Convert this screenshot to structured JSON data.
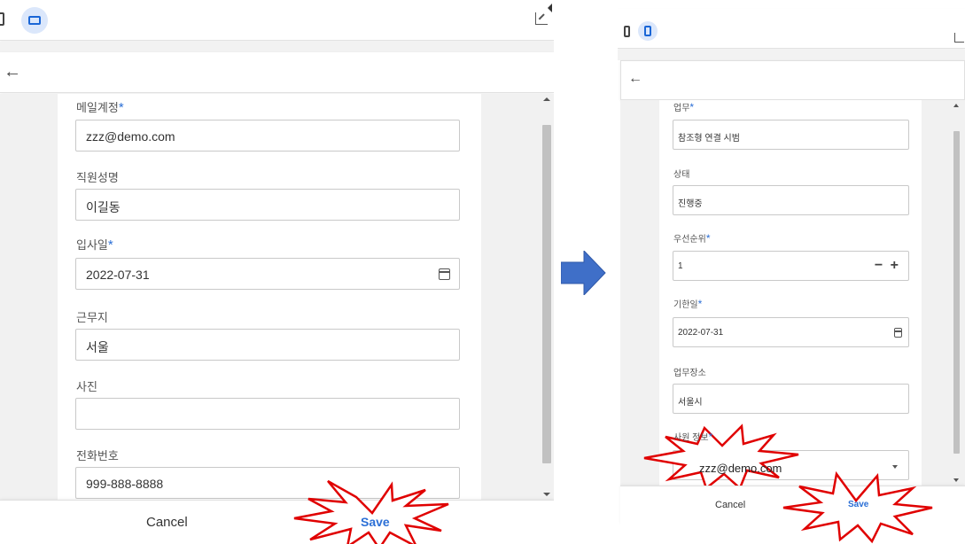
{
  "left": {
    "form": {
      "email": {
        "label": "메일계정",
        "required_mark": "*",
        "value": "zzz@demo.com"
      },
      "name": {
        "label": "직원성명",
        "value": "이길동"
      },
      "hire_date": {
        "label": "입사일",
        "required_mark": "*",
        "value": "2022-07-31"
      },
      "workplace": {
        "label": "근무지",
        "value": "서울"
      },
      "photo": {
        "label": "사진",
        "value": ""
      },
      "phone": {
        "label": "전화번호",
        "value": "999-888-8888"
      }
    },
    "footer": {
      "cancel_label": "Cancel",
      "save_label": "Save"
    }
  },
  "right": {
    "form": {
      "task": {
        "label": "업무",
        "required_mark": "*",
        "value": "참조형 연결 시범"
      },
      "status": {
        "label": "상태",
        "value": "진행중"
      },
      "priority": {
        "label": "우선순위",
        "required_mark": "*",
        "value": "1",
        "stepper": "− +"
      },
      "due_date": {
        "label": "기한일",
        "required_mark": "*",
        "value": "2022-07-31"
      },
      "location": {
        "label": "업무장소",
        "value": "서울시"
      },
      "employee": {
        "label": "사원 정보",
        "required_mark": "*",
        "value": "zzz@demo.com"
      }
    },
    "footer": {
      "cancel_label": "Cancel",
      "save_label": "Save"
    }
  },
  "colors": {
    "accent": "#2b6fd6",
    "arrow": "#3f6fc8",
    "highlight_burst": "#e00000"
  },
  "icons": [
    "phone-device-icon",
    "tablet-device-icon",
    "expand-icon",
    "back-arrow-icon",
    "calendar-icon",
    "dropdown-caret-icon",
    "next-arrow-icon",
    "burst-highlight-icon"
  ]
}
